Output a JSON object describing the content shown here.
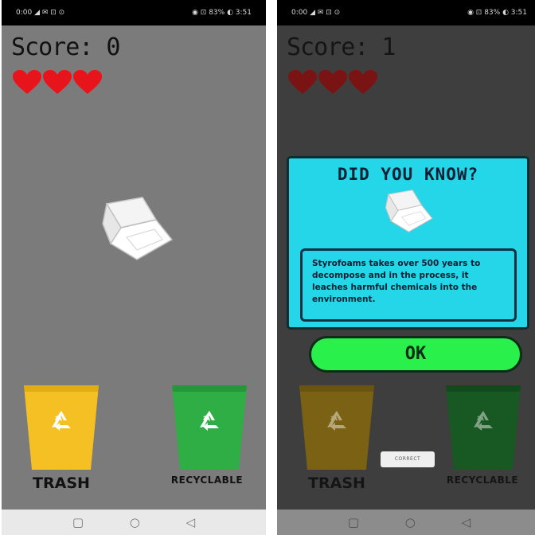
{
  "left_screen": {
    "status_bar": {
      "left": "0:00 ◢ ✉ ⊡ ⊙",
      "right": "◉ ⊡ 83% ◐ 3:51"
    },
    "score_label": "Score: 0",
    "lives": 3,
    "item": "styrofoam-container",
    "bins": {
      "trash_label": "TRASH",
      "recyclable_label": "RECYCLABLE"
    },
    "nav": {
      "square": "▢",
      "circle": "○",
      "back": "◁"
    }
  },
  "right_screen": {
    "status_bar": {
      "left": "0:00 ◢ ✉ ⊡ ⊙",
      "right": "◉ ⊡ 83% ◐ 3:51"
    },
    "score_label": "Score: 1",
    "lives": 3,
    "modal": {
      "title": "DID YOU KNOW?",
      "fact": "Styrofoams takes over 500 years to decompose and in the process, it leaches harmful chemicals into the environment.",
      "ok_label": "OK"
    },
    "correct_badge": "CORRECT",
    "bins": {
      "trash_label": "TRASH",
      "recyclable_label": "RECYCLABLE"
    },
    "nav": {
      "square": "▢",
      "circle": "○",
      "back": "◁"
    }
  },
  "colors": {
    "trash_bin": "#f5c024",
    "recycle_bin": "#2fae45",
    "heart": "#e8141b",
    "modal_bg": "#25d5e8",
    "ok_button": "#29f04a",
    "game_bg": "#7b7b7b"
  }
}
